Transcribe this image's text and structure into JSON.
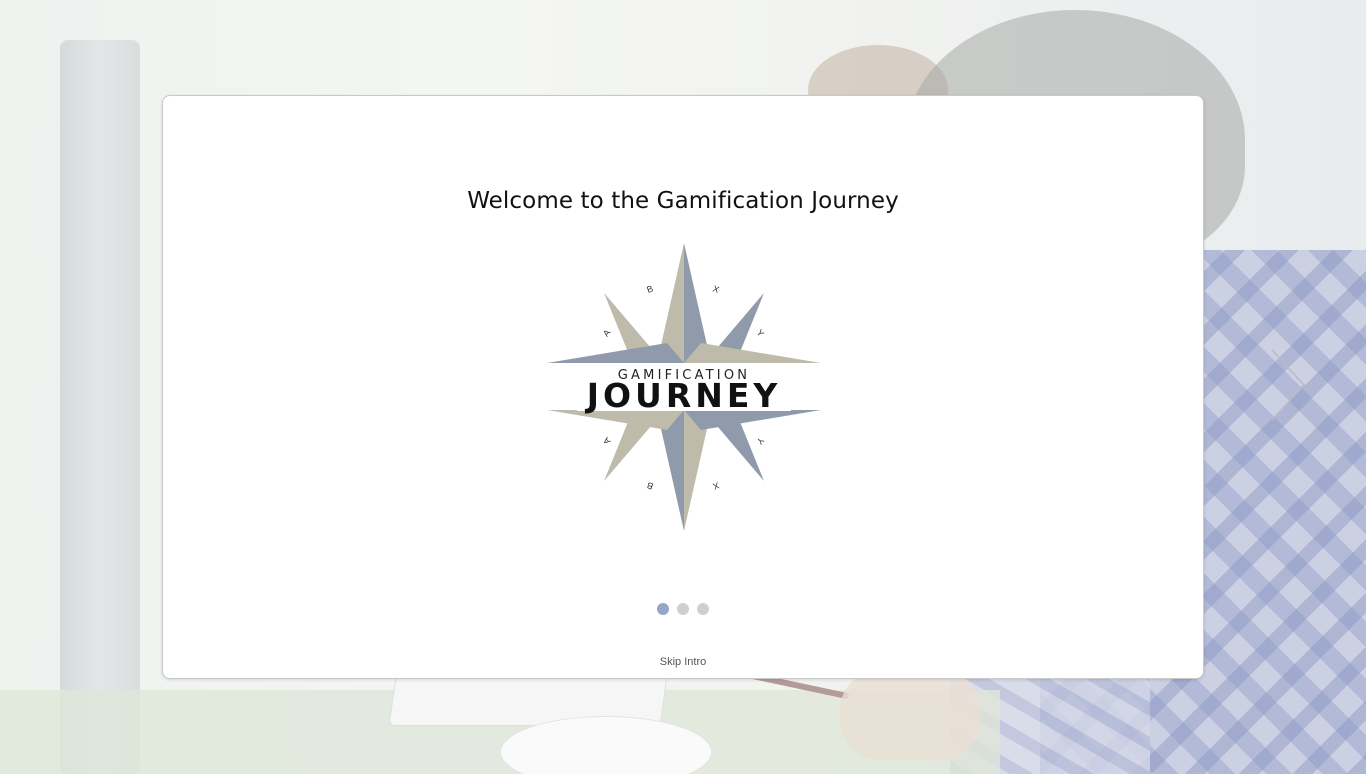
{
  "intro": {
    "title": "Welcome to the Gamification Journey",
    "skip_label": "Skip Intro",
    "slides_total": 3,
    "active_slide": 1
  },
  "logo": {
    "line1": "GAMIFICATION",
    "line2": "JOURNEY",
    "compass_letters": [
      "A",
      "B",
      "X",
      "Y"
    ],
    "colors": {
      "light": "#bfbbab",
      "dark": "#8f9bab",
      "text": "#111111"
    }
  },
  "nav": {
    "next_icon": "chevron-right-icon"
  },
  "colors": {
    "dot_active": "#94a7c9",
    "dot_inactive": "#cfcfcf"
  }
}
